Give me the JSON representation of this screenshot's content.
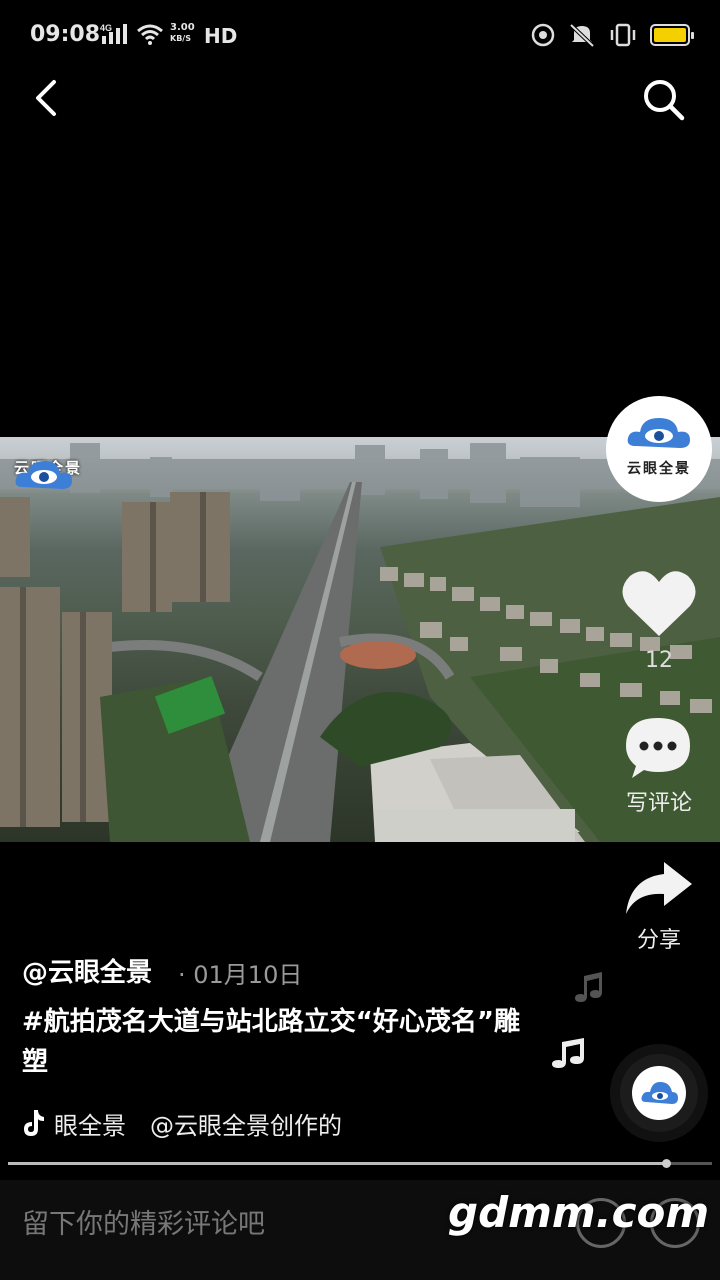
{
  "status_bar": {
    "time": "09:08",
    "network_speed": "3.00",
    "network_speed_unit": "KB/S",
    "hd_label": "HD",
    "signal_label": "4G",
    "battery_color": "#f5d000"
  },
  "header": {
    "back_icon": "chevron-left-icon",
    "search_icon": "search-icon"
  },
  "video": {
    "watermark_text": "云眼全景"
  },
  "actions": {
    "avatar_name": "云眼全景",
    "like_count": "12",
    "comment_label": "写评论",
    "share_label": "分享"
  },
  "post": {
    "author": "@云眼全景",
    "date": "· 01月10日",
    "description": "#航拍茂名大道与站北路立交“好心茂名”雕塑",
    "music_text": "眼全景　@云眼全景创作的"
  },
  "progress": {
    "fraction": 0.935
  },
  "comment_bar": {
    "placeholder": "留下你的精彩评论吧"
  },
  "site_watermark": "gdmm.com"
}
